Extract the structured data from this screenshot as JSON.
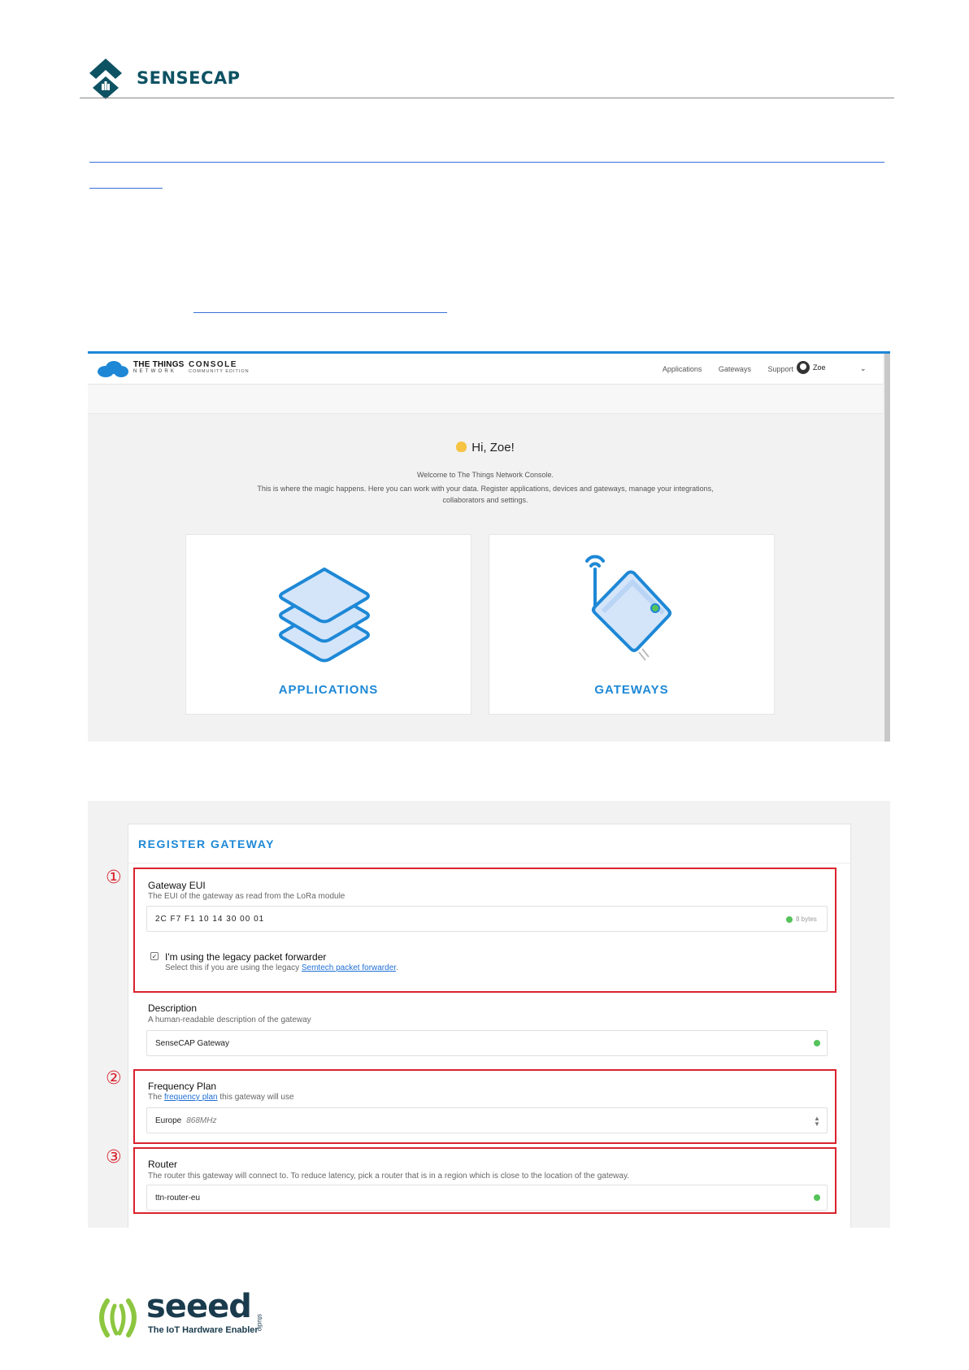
{
  "document": {
    "brand": "SENSECAP",
    "footer_brand": "seeed",
    "footer_studio": "studio",
    "footer_tagline": "The IoT Hardware Enabler",
    "watermark": "ology"
  },
  "console": {
    "brand_line1": "THE THINGS",
    "brand_line2": "NETWORK",
    "console_line1": "CONSOLE",
    "console_line2": "COMMUNITY EDITION",
    "nav": [
      "Applications",
      "Gateways",
      "Support"
    ],
    "user": "Zoe",
    "greeting": "Hi, Zoe!",
    "welcome": "Welcome to The Things Network Console.",
    "intro": "This is where the magic happens. Here you can work with your data. Register applications, devices and gateways, manage your integrations,",
    "intro2": "collaborators and settings.",
    "tiles": [
      "APPLICATIONS",
      "GATEWAYS"
    ]
  },
  "register": {
    "title": "REGISTER GATEWAY",
    "markers": [
      "①",
      "②",
      "③"
    ],
    "eui_label": "Gateway EUI",
    "eui_desc": "The EUI of the gateway as read from the LoRa module",
    "eui_value": "2C F7 F1 10 14 30 00 01",
    "eui_bytes": "8 bytes",
    "legacy_label": "I'm using the legacy packet forwarder",
    "legacy_desc_pre": "Select this if you are using the legacy ",
    "legacy_link": "Semtech packet forwarder",
    "legacy_desc_post": ".",
    "legacy_checked": true,
    "desc_label": "Description",
    "desc_desc": "A human-readable description of the gateway",
    "desc_value": "SenseCAP Gateway",
    "freq_label": "Frequency Plan",
    "freq_desc_pre": "The ",
    "freq_link": "frequency plan",
    "freq_desc_post": " this gateway will use",
    "freq_value": "Europe",
    "freq_sub": "868MHz",
    "router_label": "Router",
    "router_desc": "The router this gateway will connect to. To reduce latency, pick a router that is in a region which is close to the location of the gateway.",
    "router_value": "ttn-router-eu"
  }
}
